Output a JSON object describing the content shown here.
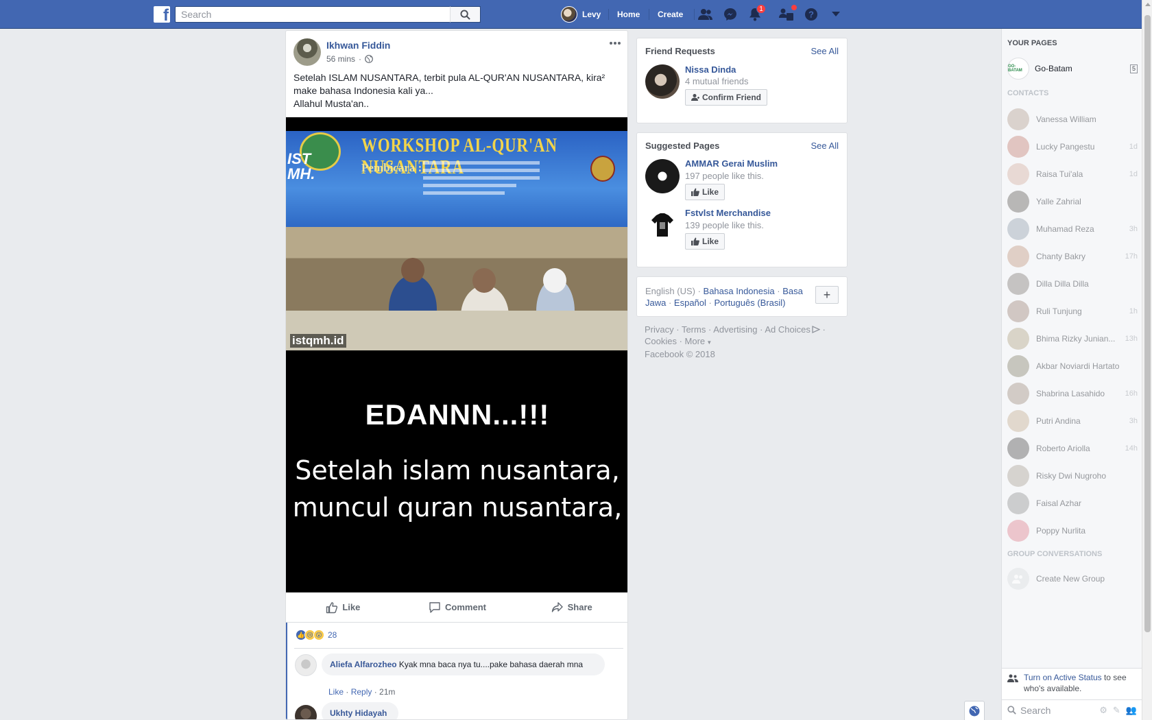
{
  "topbar": {
    "logo": "f",
    "search_placeholder": "Search",
    "profile_name": "Levy",
    "home_label": "Home",
    "create_label": "Create",
    "notifications_count": "1",
    "icons": [
      "friends-icon",
      "messenger-icon",
      "notifications-icon",
      "quick-help-icon",
      "help-icon",
      "account-menu-icon"
    ]
  },
  "post": {
    "author": "Ikhwan Fiddin",
    "time": "56 mins",
    "privacy_icon": "globe-icon",
    "text": "Setelah ISLAM NUSANTARA, terbit pula AL-QUR'AN NUSANTARA, kira² make bahasa Indonesia kali ya...\nAllahul Musta'an..",
    "image": {
      "banner_title": "WORKSHOP AL-QUR'AN NUSANTARA",
      "banner_subtitle": "Pembicara :",
      "corner_text": "IST\nMH.",
      "watermark": "istqmh.id",
      "big_text": "EDANNN...!!!",
      "caption": "Setelah islam nusantara,\nmuncul quran nusantara,"
    },
    "actions": {
      "like": "Like",
      "comment": "Comment",
      "share": "Share"
    },
    "reaction_count": "28",
    "comments": [
      {
        "name": "Aliefa Alfarozheo",
        "text": "Kyak mna baca nya tu....pake bahasa daerah mna",
        "like": "Like",
        "reply": "Reply",
        "time": "21m"
      },
      {
        "name": "Ukhty Hidayah"
      }
    ]
  },
  "friend_requests": {
    "title": "Friend Requests",
    "see_all": "See All",
    "name": "Nissa Dinda",
    "mutual": "4 mutual friends",
    "confirm_label": "Confirm Friend"
  },
  "suggested_pages": {
    "title": "Suggested Pages",
    "see_all": "See All",
    "pages": [
      {
        "name": "AMMAR Gerai Muslim",
        "likes": "197 people like this.",
        "like_label": "Like"
      },
      {
        "name": "Fstvlst Merchandise",
        "likes": "139 people like this.",
        "like_label": "Like"
      }
    ]
  },
  "languages": {
    "current": "English (US)",
    "options": [
      "Bahasa Indonesia",
      "Basa Jawa",
      "Español",
      "Português (Brasil)"
    ],
    "plus": "+"
  },
  "footer": {
    "links": [
      "Privacy",
      "Terms",
      "Advertising",
      "Ad Choices",
      "Cookies",
      "More"
    ],
    "copyright": "Facebook © 2018"
  },
  "chat": {
    "your_pages_title": "YOUR PAGES",
    "page_name": "Go-Batam",
    "page_logo_text": "GO-BATAM",
    "page_count": "5",
    "contacts_title": "CONTACTS",
    "contacts": [
      {
        "name": "Vanessa William",
        "time": "",
        "color": "#b9a79a"
      },
      {
        "name": "Lucky Pangestu",
        "time": "1d",
        "color": "#c98a7e"
      },
      {
        "name": "Raisa Tui'ala",
        "time": "1d",
        "color": "#d9b6a8"
      },
      {
        "name": "Yalle Zahrial",
        "time": "",
        "color": "#6f6a66"
      },
      {
        "name": "Muhamad Reza",
        "time": "3h",
        "color": "#9aa7b4"
      },
      {
        "name": "Chanty Bakry",
        "time": "17h",
        "color": "#c7a089"
      },
      {
        "name": "Dilla Dilla Dilla",
        "time": "",
        "color": "#8b8580"
      },
      {
        "name": "Ruli Tunjung",
        "time": "1h",
        "color": "#a58f84"
      },
      {
        "name": "Bhima Rizky Junian...",
        "time": "13h",
        "color": "#b8ab8e"
      },
      {
        "name": "Akbar Noviardi Hartato",
        "time": "",
        "color": "#8f8c78"
      },
      {
        "name": "Shabrina Lasahido",
        "time": "16h",
        "color": "#a7978a"
      },
      {
        "name": "Putri Andina",
        "time": "3h",
        "color": "#c8b49a"
      },
      {
        "name": "Roberto Ariolla",
        "time": "14h",
        "color": "#5e5e5e"
      },
      {
        "name": "Risky Dwi Nugroho",
        "time": "",
        "color": "#b0a89e"
      },
      {
        "name": "Faisal Azhar",
        "time": "",
        "color": "#9b9b9b"
      },
      {
        "name": "Poppy Nurlita",
        "time": "",
        "color": "#e08a96"
      }
    ],
    "group_title": "GROUP CONVERSATIONS",
    "create_group": "Create New Group",
    "active_status_link": "Turn on Active Status",
    "active_status_rest": " to see who's available.",
    "search_placeholder": "Search"
  },
  "colors": {
    "brand": "#4267b2",
    "link": "#365899",
    "background": "#e9ebee"
  }
}
